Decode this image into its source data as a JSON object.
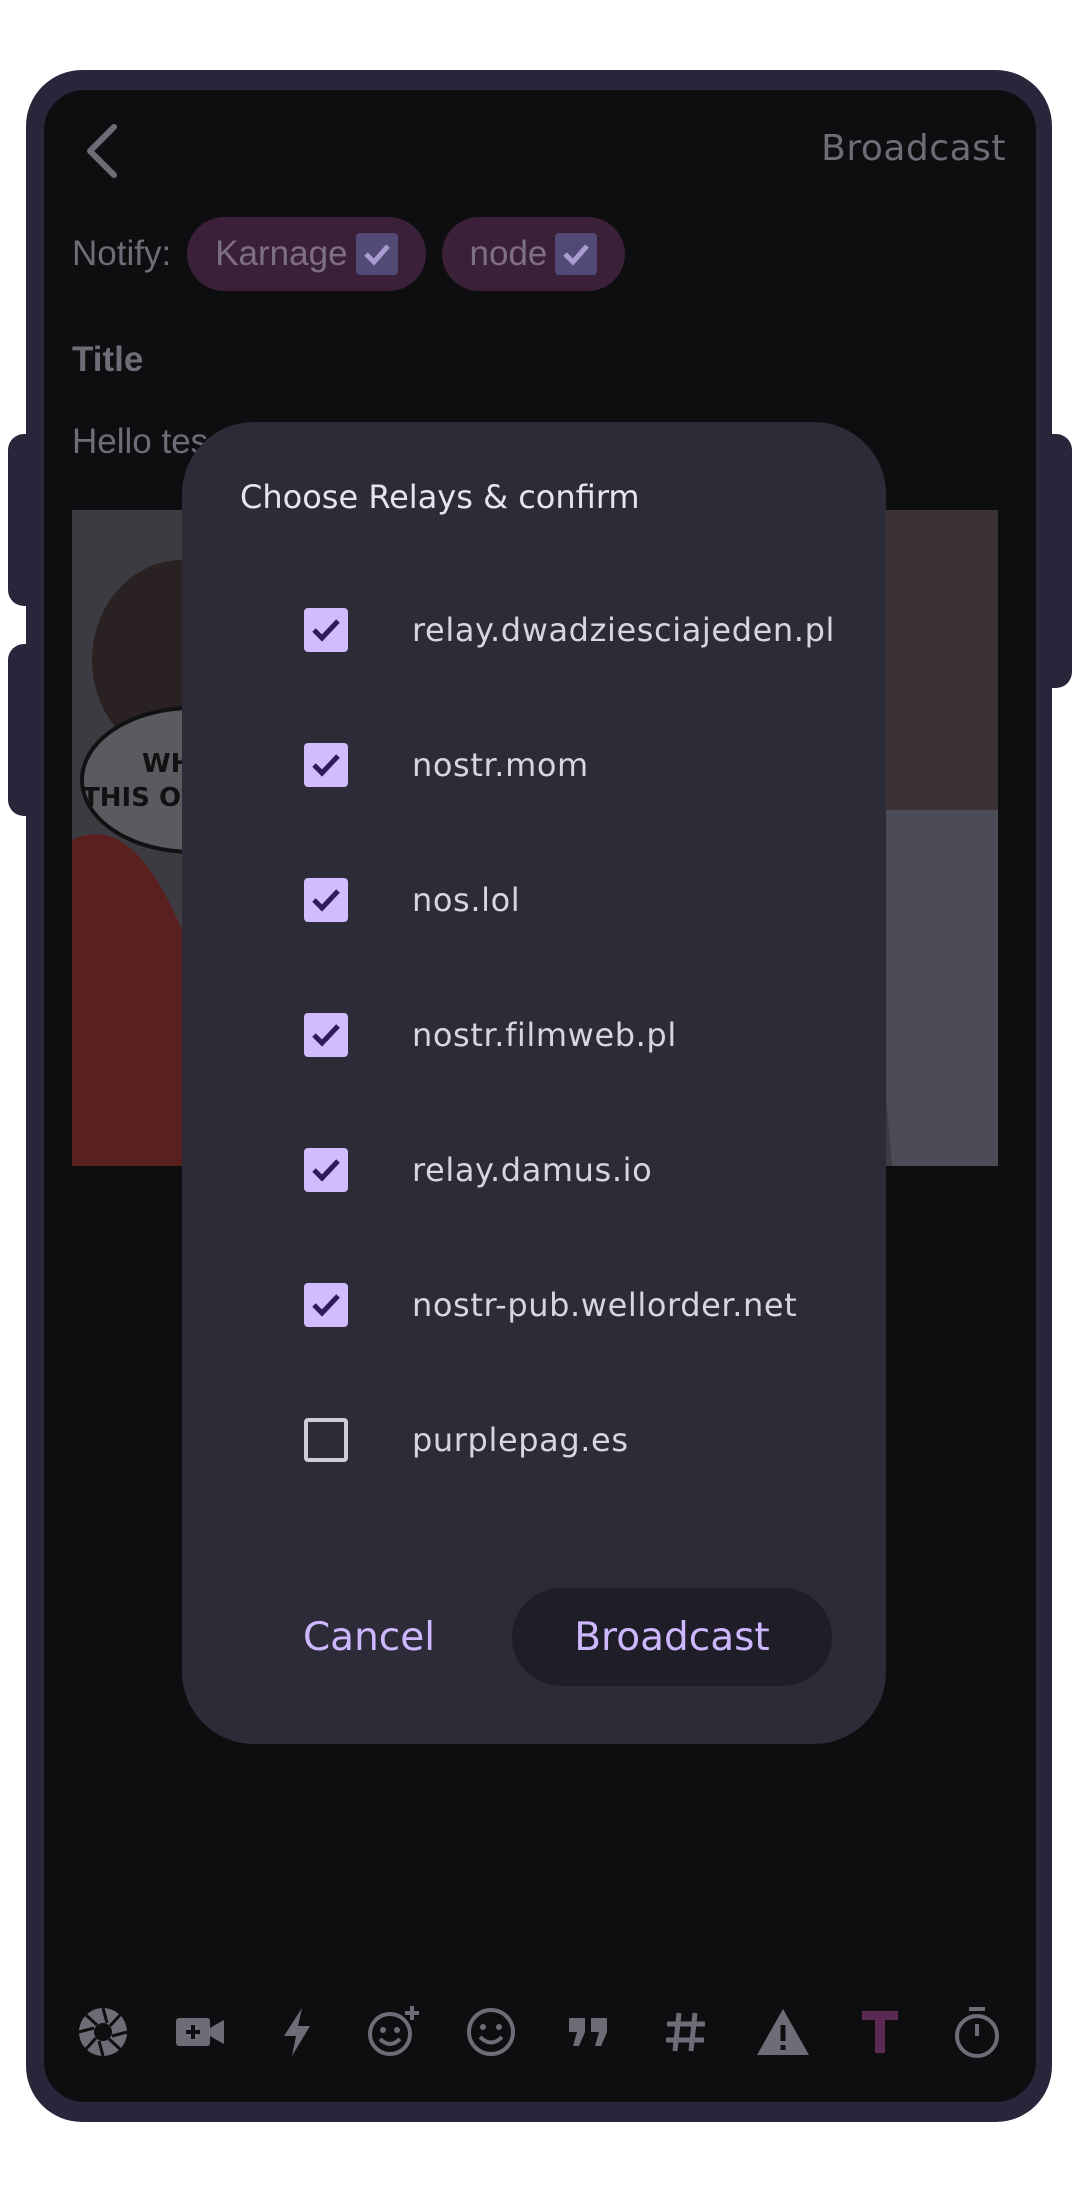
{
  "header": {
    "action_label": "Broadcast"
  },
  "notify": {
    "label": "Notify:",
    "chips": [
      {
        "label": "Karnage",
        "checked": true
      },
      {
        "label": "node",
        "checked": true
      }
    ]
  },
  "post": {
    "title_label": "Title",
    "body_preview": "Hello tes",
    "image_caption": "WH\nTHIS O"
  },
  "dialog": {
    "title": "Choose Relays & confirm",
    "relays": [
      {
        "url": "relay.dwadziesciajeden.pl",
        "checked": true
      },
      {
        "url": "nostr.mom",
        "checked": true
      },
      {
        "url": "nos.lol",
        "checked": true
      },
      {
        "url": "nostr.filmweb.pl",
        "checked": true
      },
      {
        "url": "relay.damus.io",
        "checked": true
      },
      {
        "url": "nostr-pub.wellorder.net",
        "checked": true
      },
      {
        "url": "purplepag.es",
        "checked": false
      }
    ],
    "cancel_label": "Cancel",
    "confirm_label": "Broadcast"
  },
  "toolbar": {
    "icons": [
      "camera-aperture-icon",
      "video-add-icon",
      "lightning-icon",
      "add-emoji-icon",
      "emoji-icon",
      "quote-icon",
      "hashtag-icon",
      "warning-icon",
      "text-format-icon",
      "timer-icon"
    ],
    "active_icon": "text-format-icon"
  },
  "colors": {
    "accent": "#d1bcff",
    "accent_text": "#cdb8ff",
    "dialog_bg": "#2d2b38",
    "screen_bg": "#0e0e10",
    "chip_bg": "#3a2038",
    "active_tool": "#5a2a52"
  }
}
